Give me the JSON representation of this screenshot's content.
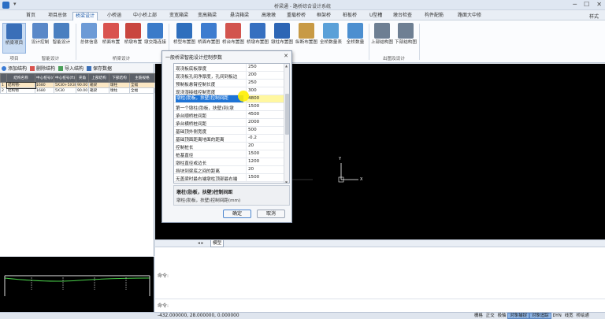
{
  "window": {
    "title": "桥梁通 - 路桥综合设计系统",
    "style_label": "样式"
  },
  "menu": [
    "首页",
    "项目总体",
    "桥梁设计",
    "小桥涵",
    "中小桥上部",
    "变宽箱梁",
    "变高箱梁",
    "悬浇箱梁",
    "高墩墩",
    "重载桥桥",
    "框架桥",
    "桩板桥",
    "U型槽",
    "墩台检查",
    "构件配筋",
    "路面大中修"
  ],
  "menu_active": "桥梁设计",
  "ribbon": {
    "buttons": [
      {
        "label": "桥梁项目",
        "icon": "bridge-project-icon"
      },
      {
        "label": "设计控制",
        "icon": "design-control-icon"
      },
      {
        "label": "智能设计",
        "icon": "smart-design-icon"
      },
      {
        "label": "总体信息",
        "icon": "general-info-icon"
      },
      {
        "label": "桥面布置",
        "icon": "deck-layout-icon"
      },
      {
        "label": "桥墩布置",
        "icon": "pier-layout-icon"
      },
      {
        "label": "墩交路连接",
        "icon": "pier-connection-icon"
      },
      {
        "label": "桥型布置图",
        "icon": "bridge-type-icon"
      },
      {
        "label": "桥面布置图",
        "icon": "deck-plan-icon"
      },
      {
        "label": "桥台布置图",
        "icon": "abutment-plan-icon"
      },
      {
        "label": "桥墩布置图",
        "icon": "pier-plan-icon"
      },
      {
        "label": "墩柱布置图",
        "icon": "column-plan-icon"
      },
      {
        "label": "纵断布置图",
        "icon": "profile-plan-icon"
      },
      {
        "label": "全桥数量表",
        "icon": "quantity-table-icon"
      },
      {
        "label": "上部结构图",
        "icon": "superstructure-icon"
      },
      {
        "label": "下部结构图",
        "icon": "substructure-icon"
      }
    ],
    "groups": [
      "项目",
      "智能设计",
      "桥梁设计",
      "出图及设计"
    ]
  },
  "left_toolbar": [
    "添加结构",
    "删除结构",
    "导入结构",
    "保存数据"
  ],
  "structure_table": {
    "headers": [
      "",
      "结构名称",
      "中心桩号(m)",
      "中心桩号(ft)",
      "夹角",
      "上部结构",
      "下部结构",
      "主筋规格"
    ],
    "rows": [
      [
        "1",
        "结构物-",
        "1680",
        "5X30+5X30",
        "90.00",
        "箱梁",
        "墩柱",
        "全幅"
      ],
      [
        "2",
        "结构物",
        "1680",
        "5X30",
        "90.00",
        "箱梁",
        "墩柱",
        "全幅"
      ]
    ]
  },
  "dialog": {
    "title": "一般桥梁智能设计控制参数",
    "params": [
      {
        "name": "现浇板底板厚度",
        "value": "250"
      },
      {
        "name": "现浇板孔间净厚度，孔间到板边",
        "value": "200"
      },
      {
        "name": "预制板悬臂控制长度",
        "value": "250"
      },
      {
        "name": "现浇湿接缝控制宽度",
        "value": "300"
      },
      {
        "name": "墩柱(肋板，扶壁)控制间距",
        "value": "4800"
      },
      {
        "name": "第一个墩柱(肋板，扶壁)到(墩",
        "value": "1500"
      },
      {
        "name": "承台顺桥桩间距",
        "value": "4500"
      },
      {
        "name": "承台横桥桩间距",
        "value": "2000"
      },
      {
        "name": "基础顶外侧宽度",
        "value": "500"
      },
      {
        "name": "基础顶面距离地面的距离",
        "value": "-0.2"
      },
      {
        "name": "控制桩长",
        "value": "20"
      },
      {
        "name": "桩基直径",
        "value": "1500"
      },
      {
        "name": "墩柱直径或边长",
        "value": "1200"
      },
      {
        "name": "挡块到梁底之间的距离",
        "value": "20"
      },
      {
        "name": "无盖梁时最右端墩柱顶部最右端",
        "value": "1500"
      }
    ],
    "selected_index": 4,
    "desc_title": "墩柱(肋板，扶壁)控制间距",
    "desc_text": "墩柱(肋板，扶壁)控制间距(mm)",
    "ok_label": "确定",
    "cancel_label": "取消"
  },
  "canvas": {
    "axis_y": "Y",
    "axis_x": "X"
  },
  "model_tab": "模型",
  "command": {
    "line1": "命令:",
    "line2": "命令:"
  },
  "status": {
    "coords": "-432.000000, 28.000000, 0.000000",
    "modes": [
      {
        "label": "栅格",
        "on": false
      },
      {
        "label": "正交",
        "on": false
      },
      {
        "label": "极轴",
        "on": false
      },
      {
        "label": "对象捕捉",
        "on": true
      },
      {
        "label": "对象追踪",
        "on": true
      },
      {
        "label": "DYN",
        "on": false
      },
      {
        "label": "线宽",
        "on": false
      },
      {
        "label": "桥绘通",
        "on": false
      }
    ]
  },
  "colors": {
    "accent": "#1e74d6",
    "highlight_value": "#fff7a0",
    "cursor": "#fff000"
  }
}
